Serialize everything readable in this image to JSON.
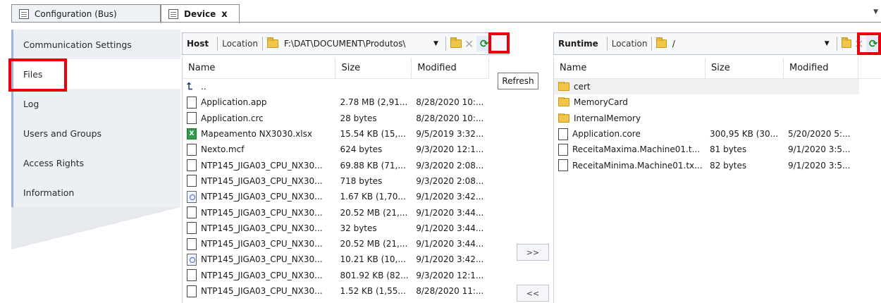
{
  "tabs": [
    {
      "label": "Configuration (Bus)",
      "active": false
    },
    {
      "label": "Device",
      "active": true,
      "close": "x"
    }
  ],
  "nav": {
    "items": [
      {
        "label": "Communication Settings"
      },
      {
        "label": "Files",
        "active": true
      },
      {
        "label": "Log"
      },
      {
        "label": "Users and Groups"
      },
      {
        "label": "Access Rights"
      },
      {
        "label": "Information"
      }
    ]
  },
  "host": {
    "title": "Host",
    "location_label": "Location",
    "path": "F:\\DAT\\DOCUMENT\\Produtos\\",
    "refresh_tooltip": "Refresh",
    "columns": {
      "name": "Name",
      "size": "Size",
      "modified": "Modified"
    },
    "files": [
      {
        "icon": "up",
        "name": "..",
        "size": "",
        "modified": ""
      },
      {
        "icon": "doc",
        "name": "Application.app",
        "size": "2.78 MB (2,91...",
        "modified": "8/28/2020 10:..."
      },
      {
        "icon": "doc",
        "name": "Application.crc",
        "size": "28 bytes",
        "modified": "8/28/2020 10:..."
      },
      {
        "icon": "xls",
        "name": "Mapeamento NX3030.xlsx",
        "size": "15.54 KB (15,...",
        "modified": "9/5/2019 3:32..."
      },
      {
        "icon": "doc",
        "name": "Nexto.mcf",
        "size": "624 bytes",
        "modified": "9/3/2020 12:1..."
      },
      {
        "icon": "doc",
        "name": "NTP145_JIGA03_CPU_NX30...",
        "size": "69.88 KB (71,...",
        "modified": "9/3/2020 2:08..."
      },
      {
        "icon": "doc",
        "name": "NTP145_JIGA03_CPU_NX30...",
        "size": "718 bytes",
        "modified": "9/3/2020 2:08..."
      },
      {
        "icon": "cfg",
        "name": "NTP145_JIGA03_CPU_NX30...",
        "size": "1.67 KB (1,70...",
        "modified": "9/1/2020 3:42..."
      },
      {
        "icon": "doc",
        "name": "NTP145_JIGA03_CPU_NX30...",
        "size": "20.52 MB (21,...",
        "modified": "9/1/2020 3:44..."
      },
      {
        "icon": "doc",
        "name": "NTP145_JIGA03_CPU_NX30...",
        "size": "32 bytes",
        "modified": "9/1/2020 3:44..."
      },
      {
        "icon": "doc",
        "name": "NTP145_JIGA03_CPU_NX30...",
        "size": "20.52 MB (21,...",
        "modified": "9/1/2020 3:44..."
      },
      {
        "icon": "cfg",
        "name": "NTP145_JIGA03_CPU_NX30...",
        "size": "10.21 KB (10,...",
        "modified": "9/1/2020 3:42..."
      },
      {
        "icon": "doc",
        "name": "NTP145_JIGA03_CPU_NX30...",
        "size": "801.92 KB (82...",
        "modified": "9/3/2020 12:1..."
      },
      {
        "icon": "doc",
        "name": "NTP145_JIGA03_CPU_NX30...",
        "size": "1.52 KB (1,55...",
        "modified": "8/28/2020 11:..."
      }
    ]
  },
  "transfer": {
    "to_runtime": ">>",
    "to_host": "<<"
  },
  "runtime": {
    "title": "Runtime",
    "location_label": "Location",
    "path": "/",
    "columns": {
      "name": "Name",
      "size": "Size",
      "modified": "Modified"
    },
    "files": [
      {
        "icon": "folder",
        "name": "cert",
        "size": "",
        "modified": "",
        "selected": true
      },
      {
        "icon": "folder",
        "name": "MemoryCard",
        "size": "",
        "modified": ""
      },
      {
        "icon": "folder",
        "name": "InternalMemory",
        "size": "",
        "modified": ""
      },
      {
        "icon": "doc",
        "name": "Application.core",
        "size": "300,95 KB (30...",
        "modified": "5/20/2020 5:..."
      },
      {
        "icon": "doc",
        "name": "ReceitaMaxima.Machine01.t...",
        "size": "81 bytes",
        "modified": "9/1/2020 3:5..."
      },
      {
        "icon": "doc",
        "name": "ReceitaMinima.Machine01.tx...",
        "size": "82 bytes",
        "modified": "9/1/2020 3:5..."
      }
    ]
  },
  "colors": {
    "highlight": "#e8000b",
    "refresh_icon": "#1d8b2c",
    "nav_bg": "#eceff4"
  }
}
